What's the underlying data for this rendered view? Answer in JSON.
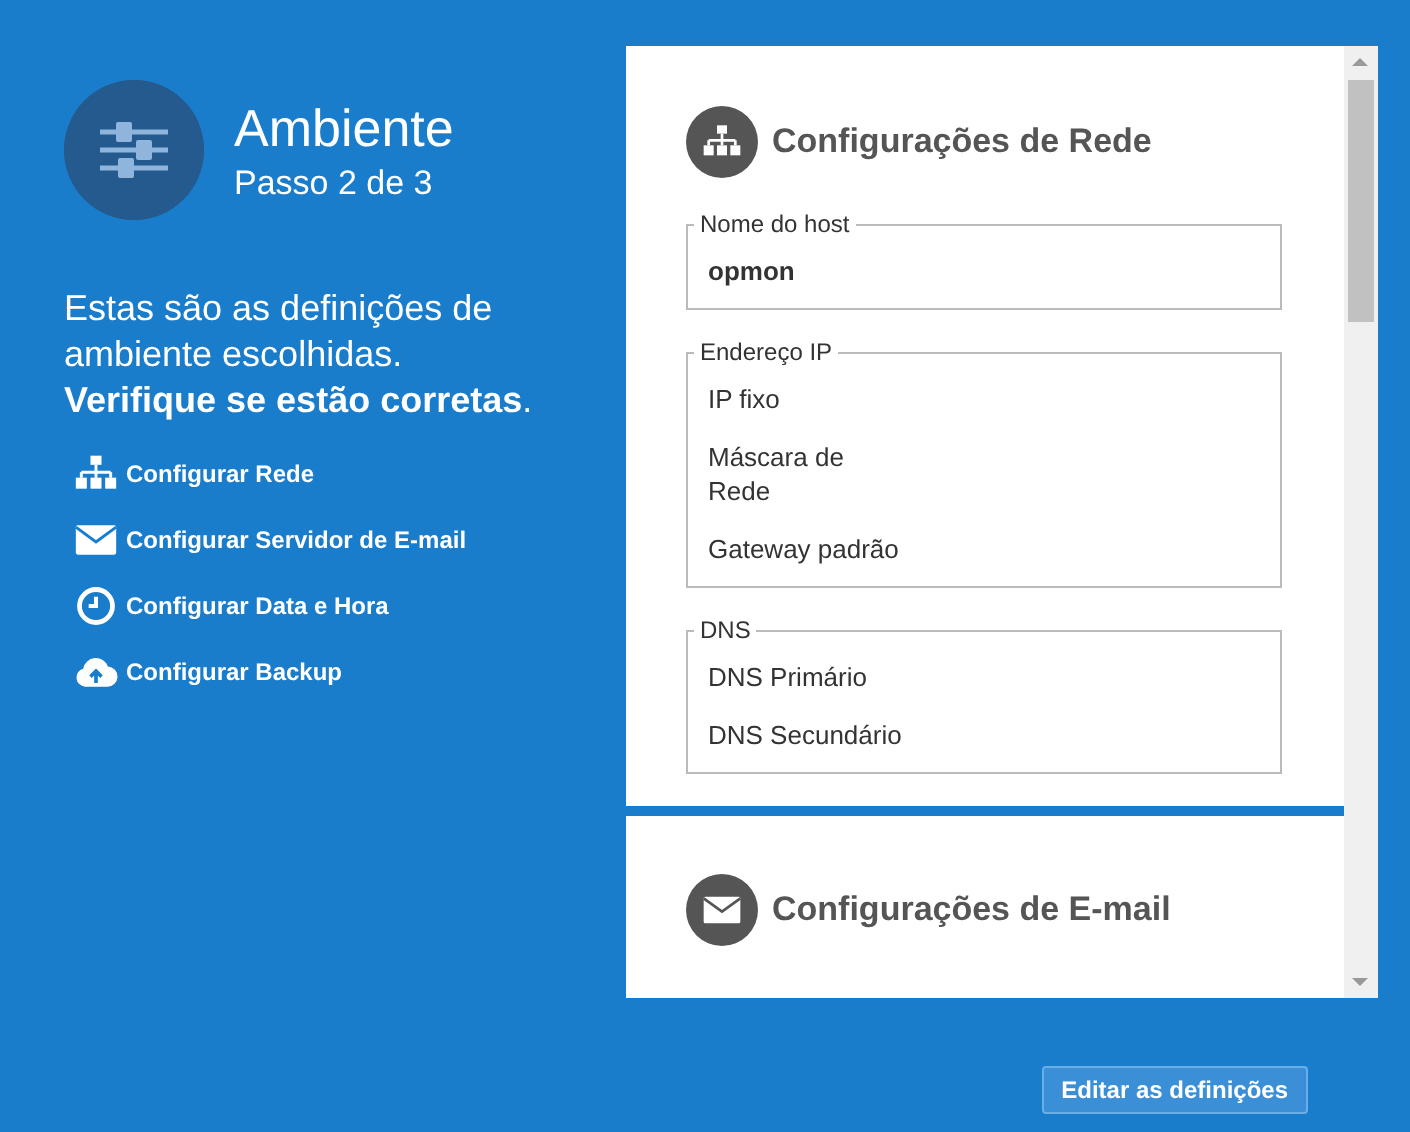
{
  "header": {
    "title": "Ambiente",
    "step": "Passo 2 de 3"
  },
  "intro": "Estas são as definições de ambiente escolhidas. **Verifique se estão corretas**.",
  "links": [
    {
      "kind": "network",
      "label": "Configurar Rede"
    },
    {
      "kind": "mail",
      "label": "Configurar Servidor de E-mail"
    },
    {
      "kind": "clock",
      "label": "Configurar Data e Hora"
    },
    {
      "kind": "upload",
      "label": "Configurar Backup"
    }
  ],
  "sections": [
    {
      "kind": "network",
      "title": "Configurações de Rede",
      "groups": [
        {
          "legend": "Nome do host",
          "rows": [
            {
              "kind": "value",
              "text": "opmon"
            }
          ]
        },
        {
          "legend": "Endereço IP",
          "rows": [
            {
              "kind": "label",
              "text": "IP fixo"
            },
            {
              "kind": "label",
              "text": "Máscara de Rede"
            },
            {
              "kind": "label",
              "text": "Gateway padrão"
            }
          ]
        },
        {
          "legend": "DNS",
          "rows": [
            {
              "kind": "label",
              "text": "DNS Primário"
            },
            {
              "kind": "label",
              "text": "DNS Secundário"
            }
          ]
        }
      ]
    },
    {
      "kind": "mail",
      "title": "Configurações de E-mail"
    }
  ],
  "button": "Editar as definições"
}
